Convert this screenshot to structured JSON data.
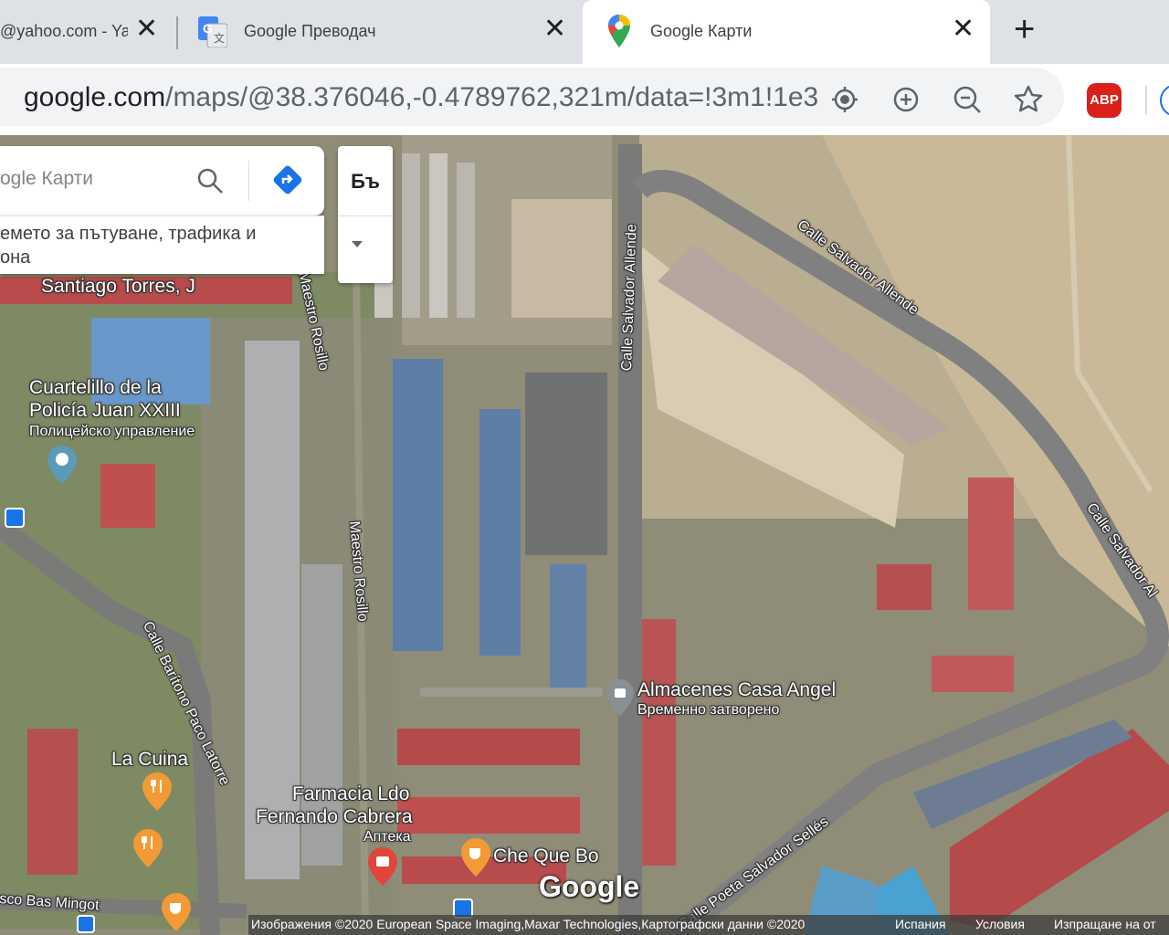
{
  "tabs": [
    {
      "title": "@yahoo.com - Yal",
      "icon": "yahoo-mail-icon"
    },
    {
      "title": "Google Преводач",
      "icon": "google-translate-icon"
    },
    {
      "title": "Google Карти",
      "icon": "google-maps-pin-icon",
      "active": true
    }
  ],
  "address_bar": {
    "url_host": "google.com",
    "url_path": "/maps/@38.376046,-0.4789762,321m/data=!3m1!1e3"
  },
  "extensions": {
    "abp_label": "ABP"
  },
  "search": {
    "placeholder": "ogle Карти"
  },
  "chips": {
    "line1": "емето за пътуване, трафика и",
    "line2": "она"
  },
  "layer_button": {
    "label": "Бъ"
  },
  "map_labels": {
    "santiago": "Santiago Torres, J",
    "maestro_rosillo_1": "Maestro Rosillo",
    "maestro_rosillo_2": "Maestro Rosillo",
    "calle_allende_vertical": "Calle Salvador Allende",
    "calle_allende_diag": "Calle Salvador Allende",
    "calle_allende_right": "Calle Salvador Al",
    "cuartelillo_1": "Cuartelillo de la",
    "cuartelillo_2": "Policía Juan XXIII",
    "cuartelillo_sub": "Полицейско управление",
    "almacenes": "Almacenes Casa Angel",
    "almacenes_sub": "Временно затворено",
    "calle_baritono": "Calle Barítono Paco Latorre",
    "la_cuina": "La Cuina",
    "farmacia_1": "Farmacia Ldo",
    "farmacia_2": "Fernando Cabrera",
    "farmacia_sub": "Аптека",
    "che_que_bo": "Che Que Bo",
    "calle_poeta": "Calle Poeta Salvador Sellés",
    "bas_mingot": "sco Bas Mingot",
    "google_logo": "Google"
  },
  "footer": {
    "imagery": "Изображения ©2020 European Space Imaging,Maxar Technologies,Картографски данни ©2020",
    "country": "Испания",
    "terms": "Условия",
    "feedback": "Изпращане на от"
  },
  "colors": {
    "tab_bar": "#dee1e6",
    "omnibox": "#f1f3f4",
    "abp_red": "#d9201a",
    "directions_blue": "#1a73e8",
    "poi_orange": "#f29a35",
    "poi_pharmacy": "#e0443a"
  }
}
